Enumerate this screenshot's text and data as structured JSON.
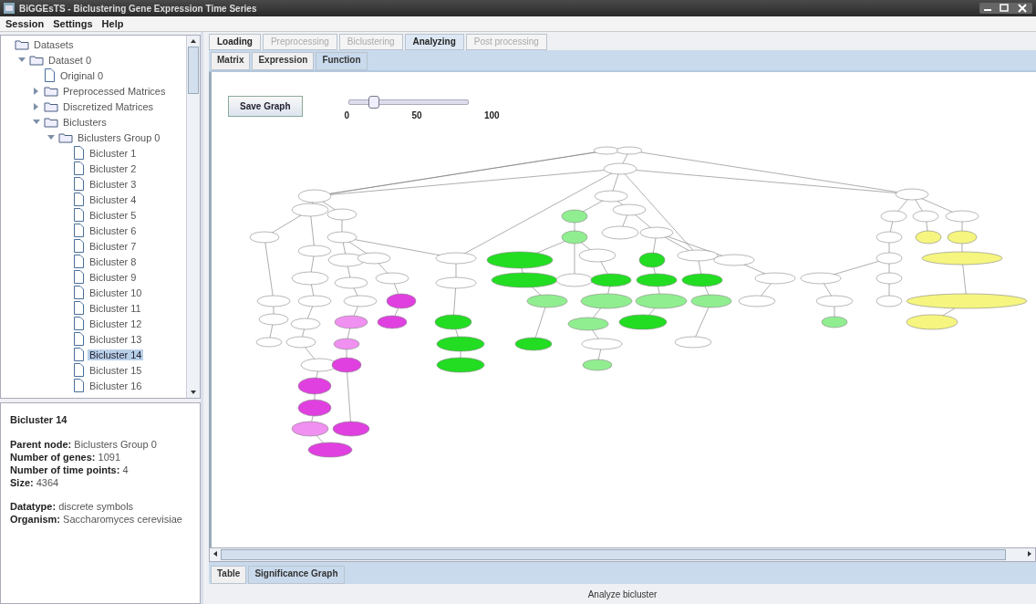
{
  "window": {
    "title": "BiGGEsTS - Biclustering Gene Expression Time Series"
  },
  "menu": [
    "Session",
    "Settings",
    "Help"
  ],
  "tree": [
    {
      "label": "Datasets",
      "kind": "folder",
      "children": [
        {
          "label": "Dataset 0",
          "kind": "folder",
          "expanded": true,
          "children": [
            {
              "label": "Original 0",
              "kind": "file"
            },
            {
              "label": "Preprocessed Matrices",
              "kind": "folder",
              "expanded": false
            },
            {
              "label": "Discretized Matrices",
              "kind": "folder",
              "expanded": false
            },
            {
              "label": "Biclusters",
              "kind": "folder",
              "expanded": true,
              "children": [
                {
                  "label": "Biclusters Group 0",
                  "kind": "folder",
                  "expanded": true,
                  "children": [
                    {
                      "label": "Bicluster 1",
                      "kind": "file",
                      "selected": false
                    },
                    {
                      "label": "Bicluster 2",
                      "kind": "file",
                      "selected": false
                    },
                    {
                      "label": "Bicluster 3",
                      "kind": "file",
                      "selected": false
                    },
                    {
                      "label": "Bicluster 4",
                      "kind": "file",
                      "selected": false
                    },
                    {
                      "label": "Bicluster 5",
                      "kind": "file",
                      "selected": false
                    },
                    {
                      "label": "Bicluster 6",
                      "kind": "file",
                      "selected": false
                    },
                    {
                      "label": "Bicluster 7",
                      "kind": "file",
                      "selected": false
                    },
                    {
                      "label": "Bicluster 8",
                      "kind": "file",
                      "selected": false
                    },
                    {
                      "label": "Bicluster 9",
                      "kind": "file",
                      "selected": false
                    },
                    {
                      "label": "Bicluster 10",
                      "kind": "file",
                      "selected": false
                    },
                    {
                      "label": "Bicluster 11",
                      "kind": "file",
                      "selected": false
                    },
                    {
                      "label": "Bicluster 12",
                      "kind": "file",
                      "selected": false
                    },
                    {
                      "label": "Bicluster 13",
                      "kind": "file",
                      "selected": false
                    },
                    {
                      "label": "Bicluster 14",
                      "kind": "file",
                      "selected": true
                    },
                    {
                      "label": "Bicluster 15",
                      "kind": "file",
                      "selected": false
                    },
                    {
                      "label": "Bicluster 16",
                      "kind": "file",
                      "selected": false
                    }
                  ]
                }
              ]
            }
          ]
        }
      ]
    }
  ],
  "info": {
    "title": "Bicluster 14",
    "lines": [
      "**Parent node:** Biclusters Group 0",
      "**Number of genes:** 1091",
      "**Number of time points:** 4",
      "**Size:** 4364"
    ],
    "lines_2": [
      "**Datatype:** discrete symbols",
      "**Organism:** Saccharomyces cerevisiae"
    ]
  },
  "tabs": [
    {
      "label": "Loading",
      "selected": false,
      "disabled": false
    },
    {
      "label": "Preprocessing",
      "selected": false,
      "disabled": true
    },
    {
      "label": "Biclustering",
      "selected": false,
      "disabled": true
    },
    {
      "label": "Analyzing",
      "selected": true,
      "disabled": false
    },
    {
      "label": "Post processing",
      "selected": false,
      "disabled": true
    }
  ],
  "subtabs": [
    {
      "label": "Matrix",
      "selected": false
    },
    {
      "label": "Expression",
      "selected": false
    },
    {
      "label": "Function",
      "selected": true
    }
  ],
  "toolbar": {
    "button": "Save Graph",
    "slider": {
      "level": 0.2,
      "ticks": [
        "0",
        "50",
        "100"
      ]
    }
  },
  "bottom_tabs": [
    {
      "label": "Table",
      "selected": false
    },
    {
      "label": "Significance Graph",
      "selected": true
    }
  ],
  "status_bar": "Analyze bicluster"
}
